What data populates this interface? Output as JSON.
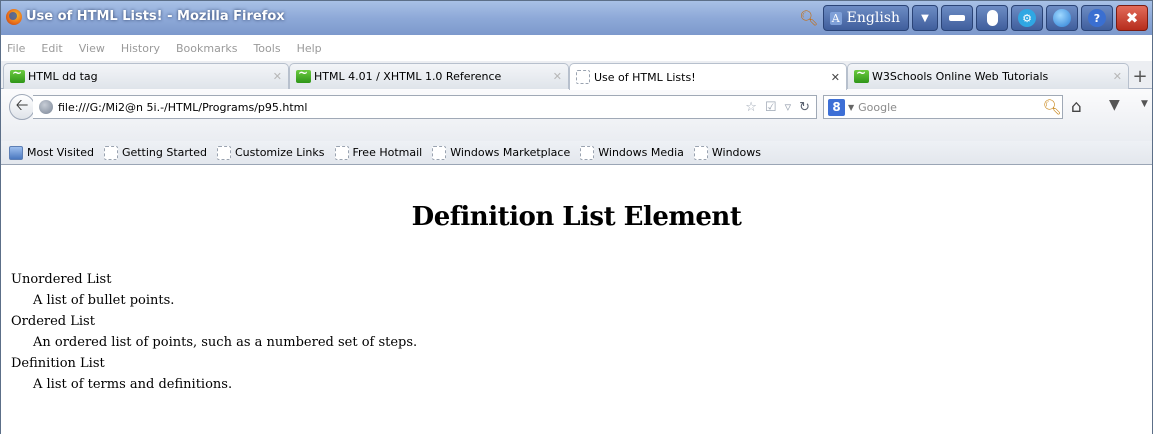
{
  "window": {
    "title": "Use of HTML Lists! - Mozilla Firefox",
    "language": "English",
    "language_glyph": "A"
  },
  "menu": [
    "File",
    "Edit",
    "View",
    "History",
    "Bookmarks",
    "Tools",
    "Help"
  ],
  "tabs": [
    {
      "label": "HTML dd tag",
      "active": false
    },
    {
      "label": "HTML 4.01 / XHTML 1.0 Reference",
      "active": false
    },
    {
      "label": "Use of HTML Lists!",
      "active": true
    },
    {
      "label": "W3Schools Online Web Tutorials",
      "active": false
    }
  ],
  "nav": {
    "url": "file:///G:/Mi2@n 5i.-/HTML/Programs/p95.html",
    "search_engine_badge": "8",
    "search_placeholder": "Google"
  },
  "bookmarks": [
    "Most Visited",
    "Getting Started",
    "Customize Links",
    "Free Hotmail",
    "Windows Marketplace",
    "Windows Media",
    "Windows"
  ],
  "page": {
    "heading": "Definition List Element",
    "terms": [
      {
        "term": "Unordered List",
        "definition": "A list of bullet points."
      },
      {
        "term": "Ordered List",
        "definition": "An ordered list of points, such as a numbered set of steps."
      },
      {
        "term": "Definition List",
        "definition": "A list of terms and definitions."
      }
    ]
  },
  "icons": {
    "title_search": "search-icon",
    "minimize": "minimize-icon",
    "mouse": "mouse-icon",
    "settings": "gear-icon",
    "globe": "globe-icon",
    "help": "help-icon",
    "close": "close-icon"
  }
}
